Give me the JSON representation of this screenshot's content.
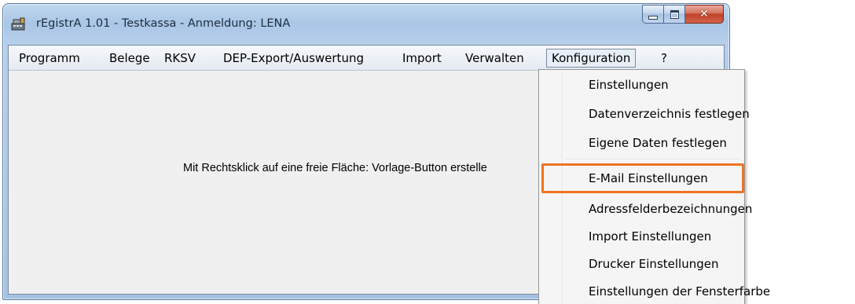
{
  "window": {
    "title": "rEgistrA 1.01 - Testkassa - Anmeldung: LENA",
    "icons": {
      "app": "register-app-icon",
      "minimize": "minimize-icon",
      "maximize": "maximize-icon",
      "close": "close-icon"
    }
  },
  "menubar": {
    "items": [
      {
        "label": "Programm"
      },
      {
        "label": "Belege"
      },
      {
        "label": "RKSV"
      },
      {
        "label": "DEP-Export/Auswertung"
      },
      {
        "label": "Import"
      },
      {
        "label": "Verwalten"
      },
      {
        "label": "Konfiguration",
        "active": true
      },
      {
        "label": "?"
      }
    ]
  },
  "main": {
    "hint_text": "Mit Rechtsklick auf eine freie Fläche: Vorlage-Button erstelle"
  },
  "dropdown": {
    "items": [
      {
        "label": "Einstellungen"
      },
      {
        "label": "Datenverzeichnis festlegen"
      },
      {
        "label": "Eigene Daten festlegen"
      },
      {
        "label": "E-Mail Einstellungen",
        "highlighted": true
      },
      {
        "label": "Adressfelderbezeichnungen"
      },
      {
        "label": "Import Einstellungen"
      },
      {
        "label": "Drucker Einstellungen"
      },
      {
        "label": "Einstellungen der Fensterfarbe"
      }
    ]
  },
  "colors": {
    "highlight_border": "#ee7421",
    "title_text": "#1e2d3f"
  }
}
